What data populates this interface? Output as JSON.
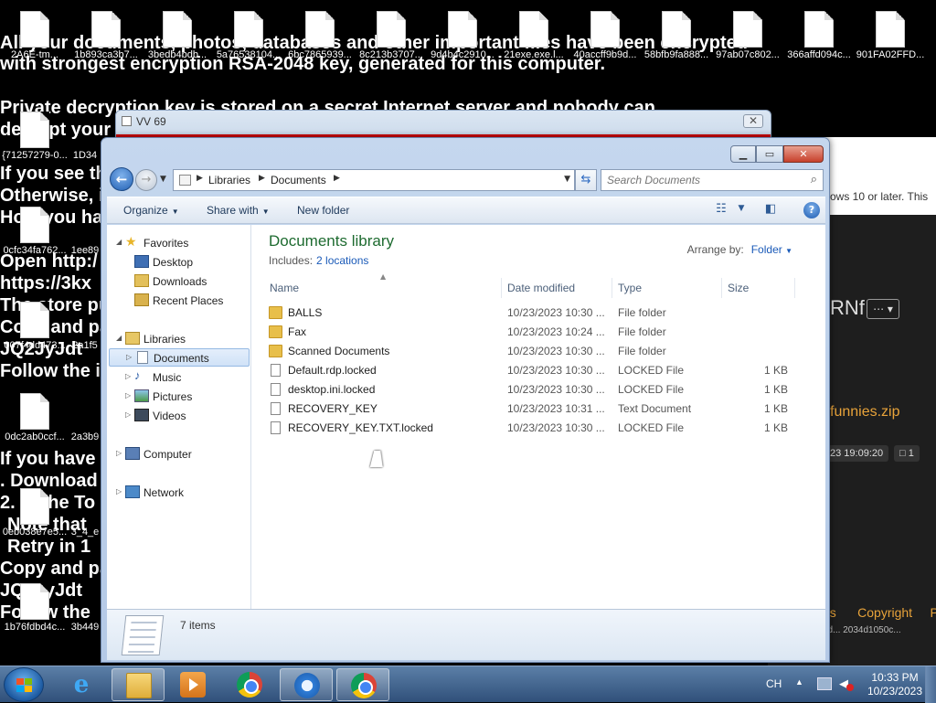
{
  "ransom_note": [
    "All your documents, photos, databases and other important files have been encrypted",
    "with strongest encryption RSA-2048 key, generated for this computer.",
    "Private decryption key is stored on a secret Internet server and nobody can",
    "decrypt your",
    "If you see th",
    "Otherwise, i",
    "How you ha",
    "Open http:/",
    "https://3kx",
    "The store pu",
    "Copy and pa",
    "JQ2JyJdt",
    "Follow the i",
    "If you have",
    ". Download",
    "2. In the To",
    "Note that",
    "Retry in 1",
    "Copy and pa",
    "JQ2JyJdt",
    "Follow the"
  ],
  "desktop_icons": [
    "2A6E-tm...",
    "1b893ca3b7...",
    "3bedb4bdb...",
    "5a76538104...",
    "6bc7865939...",
    "8c213b3707...",
    "9d4b4c2910...",
    "21exe.exe.l...",
    "40accff9b9d...",
    "58bfb9fa888...",
    "97ab07c802...",
    "366affd094c...",
    "901FA02FFD...",
    "{71257279-0...",
    "1D34",
    "0cfc34fa762...",
    "1ee89",
    "007f4dd473...",
    "2a1f5",
    "0dc2ab0ccf...",
    "2a3b9",
    "0eb038e7e5...",
    "3_4_e",
    "1b76fdbd4c...",
    "3b449"
  ],
  "background_window": {
    "title": "VV 69"
  },
  "background_browser": {
    "banner_text": "ows 10 or later. This",
    "heading_fragment": "RNf",
    "more_label": "⋯ ▾",
    "zip_name": "funnies.zip",
    "date_badge": "23 19:09:20",
    "count_badge": "□ 1",
    "footer_link1": "ns",
    "footer_link2": "Copyright",
    "footer_link3": "P",
    "footer_hash": "dd...  2034d1050c..."
  },
  "explorer": {
    "breadcrumb": [
      "Libraries",
      "Documents"
    ],
    "search_placeholder": "Search Documents",
    "toolbar": {
      "organize": "Organize",
      "share_with": "Share with",
      "new_folder": "New folder"
    },
    "nav": {
      "favorites": "Favorites",
      "desktop": "Desktop",
      "downloads": "Downloads",
      "recent_places": "Recent Places",
      "libraries": "Libraries",
      "documents": "Documents",
      "music": "Music",
      "pictures": "Pictures",
      "videos": "Videos",
      "computer": "Computer",
      "network": "Network"
    },
    "library_title": "Documents library",
    "includes_label": "Includes:",
    "includes_link": "2 locations",
    "arrange_by_label": "Arrange by:",
    "arrange_by_value": "Folder",
    "columns": {
      "name": "Name",
      "date": "Date modified",
      "type": "Type",
      "size": "Size"
    },
    "files": [
      {
        "name": "BALLS",
        "date": "10/23/2023 10:30 ...",
        "type": "File folder",
        "size": "",
        "kind": "folder"
      },
      {
        "name": "Fax",
        "date": "10/23/2023 10:24 ...",
        "type": "File folder",
        "size": "",
        "kind": "folder"
      },
      {
        "name": "Scanned Documents",
        "date": "10/23/2023 10:30 ...",
        "type": "File folder",
        "size": "",
        "kind": "folder"
      },
      {
        "name": "Default.rdp.locked",
        "date": "10/23/2023 10:30 ...",
        "type": "LOCKED File",
        "size": "1 KB",
        "kind": "file"
      },
      {
        "name": "desktop.ini.locked",
        "date": "10/23/2023 10:30 ...",
        "type": "LOCKED File",
        "size": "1 KB",
        "kind": "file"
      },
      {
        "name": "RECOVERY_KEY",
        "date": "10/23/2023 10:31 ...",
        "type": "Text Document",
        "size": "1 KB",
        "kind": "file"
      },
      {
        "name": "RECOVERY_KEY.TXT.locked",
        "date": "10/23/2023 10:30 ...",
        "type": "LOCKED File",
        "size": "1 KB",
        "kind": "file"
      }
    ],
    "item_count": "7 items"
  },
  "taskbar": {
    "lang": "CH",
    "time": "10:33 PM",
    "date": "10/23/2023"
  }
}
